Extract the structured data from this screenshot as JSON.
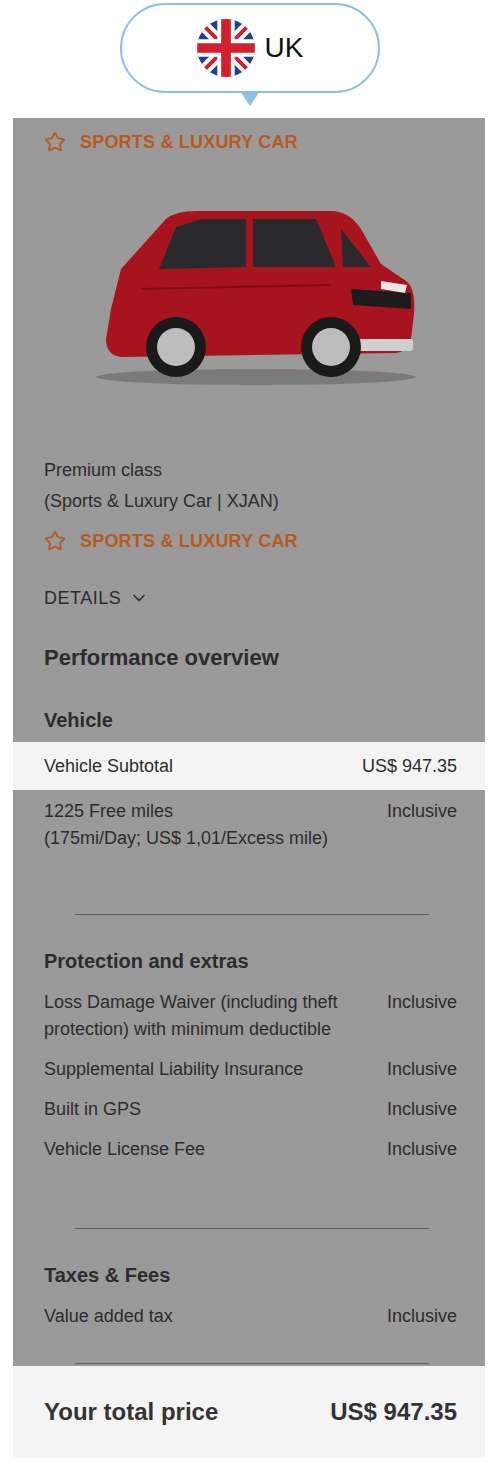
{
  "locale": {
    "label": "UK"
  },
  "vehicle_card": {
    "badge": "SPORTS & LUXURY CAR",
    "class_name": "Premium class",
    "class_detail": "(Sports & Luxury Car | XJAN)",
    "badge_secondary": "SPORTS & LUXURY CAR",
    "details_toggle": {
      "label": "DETAILS",
      "expanded": false
    }
  },
  "overview_title": "Performance overview",
  "sections": [
    {
      "title": "Vehicle",
      "rows": [
        {
          "label": "Vehicle Subtotal",
          "note": "",
          "value": "US$ 947.35",
          "highlighted": true
        },
        {
          "label": "1225 Free miles",
          "note": "(175mi/Day; US$ 1,01/Excess mile)",
          "value": "Inclusive",
          "highlighted": false
        }
      ]
    },
    {
      "title": "Protection and extras",
      "rows": [
        {
          "label": "Loss Damage Waiver (including theft protection) with minimum deductible",
          "note": "",
          "value": "Inclusive",
          "highlighted": false
        },
        {
          "label": "Supplemental Liability Insurance",
          "note": "",
          "value": "Inclusive",
          "highlighted": false
        },
        {
          "label": "Built in GPS",
          "note": "",
          "value": "Inclusive",
          "highlighted": false
        },
        {
          "label": "Vehicle License Fee",
          "note": "",
          "value": "Inclusive",
          "highlighted": false
        }
      ]
    },
    {
      "title": "Taxes & Fees",
      "rows": [
        {
          "label": "Value added tax",
          "note": "",
          "value": "Inclusive",
          "highlighted": false
        }
      ]
    }
  ],
  "total": {
    "label": "Your total price",
    "value": "US$ 947.35",
    "highlighted": true
  }
}
